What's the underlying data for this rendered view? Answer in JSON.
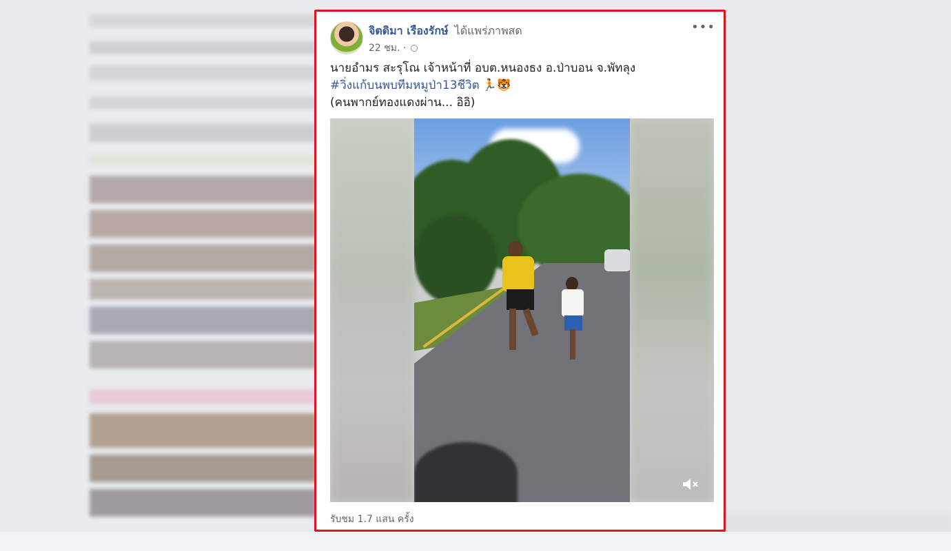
{
  "post": {
    "author_name": "จิตดิมา เรืองรักษ์",
    "author_action": "ได้แพร่ภาพสด",
    "timestamp": "22 ชม.",
    "separator": "·",
    "privacy_icon": "globe-icon",
    "more_label": "•••",
    "caption_line1": "นายอำมร สะรุโณ เจ้าหน้าที่ อบต.หนองธง อ.ป่าบอน จ.พัทลุง",
    "hashtag": "#วิ่งแก้บนพบทีมหมูป่า13ชีวิต",
    "emoji": "🏃🐯",
    "caption_line3": "(คนพากย์ทองแดงผ่าน... อิอิ)",
    "view_count": "รับชม 1.7 แสน ครั้ง",
    "mute_icon": "speaker-muted-icon"
  },
  "colors": {
    "highlight_border": "#e3141f",
    "link_blue": "#365899",
    "meta_gray": "#616770"
  }
}
